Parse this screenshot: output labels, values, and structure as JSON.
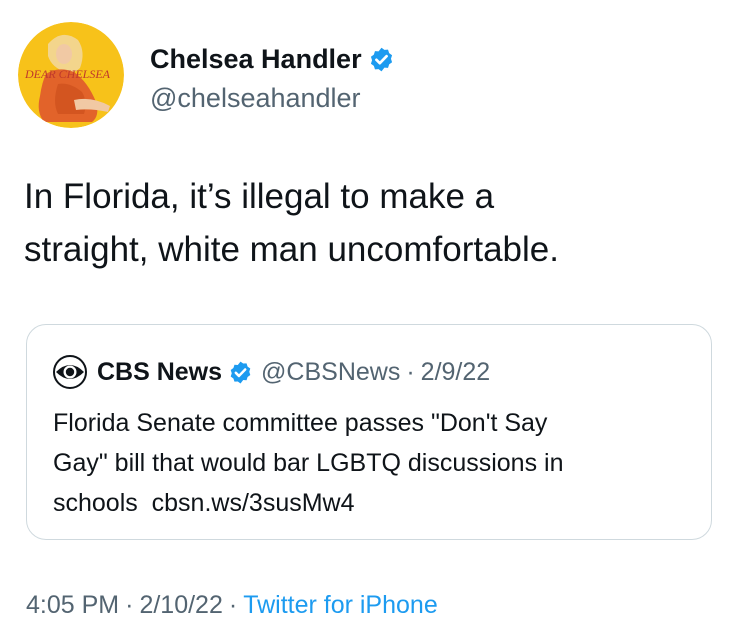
{
  "tweet": {
    "author": {
      "name": "Chelsea Handler",
      "handle": "@chelseahandler",
      "avatar_text": "DEAR CHELSEA",
      "verified_color": "#1d9bf0"
    },
    "text_line1": "In Florida, it’s illegal to make a",
    "text_line2": "straight, white man uncomfortable.",
    "quote": {
      "name": "CBS News",
      "handle": "@CBSNews",
      "separator": "·",
      "date": "2/9/22",
      "text_line1": "Florida Senate committee passes \"Don't Say",
      "text_line2": "Gay\" bill that would bar LGBTQ discussions in",
      "text_line3": "schools  cbsn.ws/3susMw4"
    },
    "meta": {
      "time": "4:05 PM",
      "separator": "·",
      "date": "2/10/22",
      "source": "Twitter for iPhone"
    }
  },
  "colors": {
    "text": "#0f1419",
    "secondary": "#536471",
    "accent": "#1d9bf0",
    "border": "#cfd9de",
    "avatar_bg": "#f5c518"
  }
}
